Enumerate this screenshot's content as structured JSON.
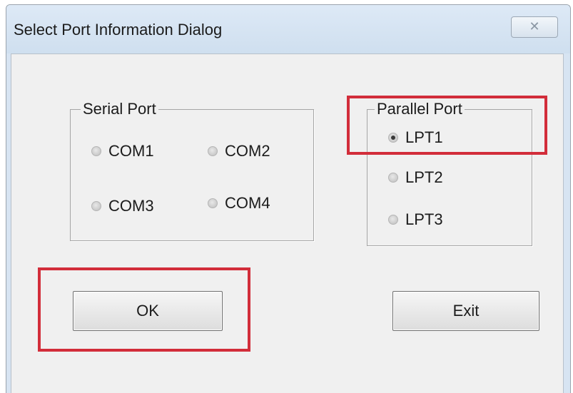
{
  "window": {
    "title": "Select Port Information Dialog",
    "close_glyph": "✕",
    "close_icon": "close-icon"
  },
  "serial_port": {
    "label": "Serial Port",
    "options": [
      {
        "label": "COM1",
        "checked": false
      },
      {
        "label": "COM2",
        "checked": false
      },
      {
        "label": "COM3",
        "checked": false
      },
      {
        "label": "COM4",
        "checked": false
      }
    ]
  },
  "parallel_port": {
    "label": "Parallel Port",
    "options": [
      {
        "label": "LPT1",
        "checked": true
      },
      {
        "label": "LPT2",
        "checked": false
      },
      {
        "label": "LPT3",
        "checked": false
      }
    ]
  },
  "buttons": {
    "ok_label": "OK",
    "exit_label": "Exit"
  },
  "colors": {
    "highlight": "#d22d3a",
    "titlebar": "#d7e4f2",
    "client_bg": "#f0f0f0"
  }
}
